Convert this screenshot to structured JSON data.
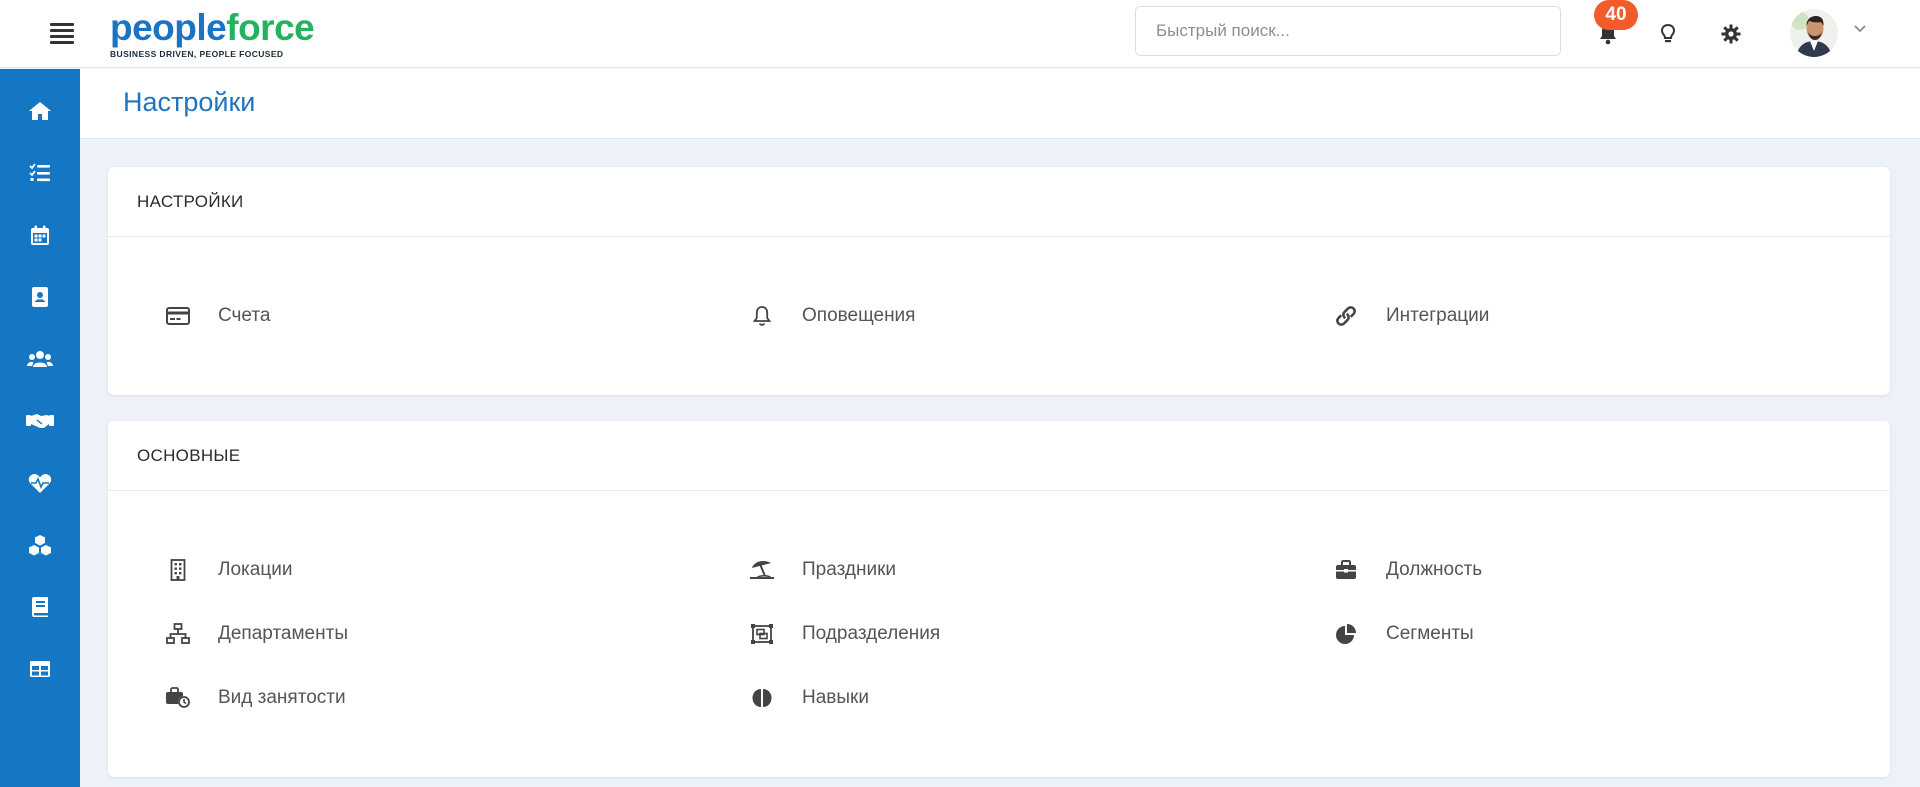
{
  "brand": {
    "name_part1": "people",
    "name_part2": "force",
    "tagline": "BUSINESS DRIVEN, PEOPLE FOCUSED"
  },
  "header": {
    "search_placeholder": "Быстрый поиск...",
    "notifications_count": "40"
  },
  "sidebar": {
    "items": [
      {
        "icon": "home-icon"
      },
      {
        "icon": "tasks-icon"
      },
      {
        "icon": "calendar-icon"
      },
      {
        "icon": "contact-card-icon"
      },
      {
        "icon": "users-icon"
      },
      {
        "icon": "handshake-icon"
      },
      {
        "icon": "heartbeat-icon"
      },
      {
        "icon": "cubes-icon"
      },
      {
        "icon": "book-icon"
      },
      {
        "icon": "table-icon"
      }
    ]
  },
  "page": {
    "title": "Настройки"
  },
  "sections": [
    {
      "title": "НАСТРОЙКИ",
      "items": [
        {
          "label": "Счета",
          "icon": "credit-card-icon"
        },
        {
          "label": "Оповещения",
          "icon": "bell-icon"
        },
        {
          "label": "Интеграции",
          "icon": "link-icon"
        }
      ]
    },
    {
      "title": "ОСНОВНЫЕ",
      "items": [
        {
          "label": "Локации",
          "icon": "building-icon"
        },
        {
          "label": "Праздники",
          "icon": "umbrella-beach-icon"
        },
        {
          "label": "Должность",
          "icon": "briefcase-icon"
        },
        {
          "label": "Департаменты",
          "icon": "sitemap-icon"
        },
        {
          "label": "Подразделения",
          "icon": "object-group-icon"
        },
        {
          "label": "Сегменты",
          "icon": "pie-chart-icon"
        },
        {
          "label": "Вид занятости",
          "icon": "briefcase-clock-icon"
        },
        {
          "label": "Навыки",
          "icon": "brain-icon"
        }
      ]
    }
  ],
  "colors": {
    "sidebar": "#1576c4",
    "accent_title": "#1f74bf",
    "badge": "#f25c2a",
    "background": "#edf2f8"
  }
}
